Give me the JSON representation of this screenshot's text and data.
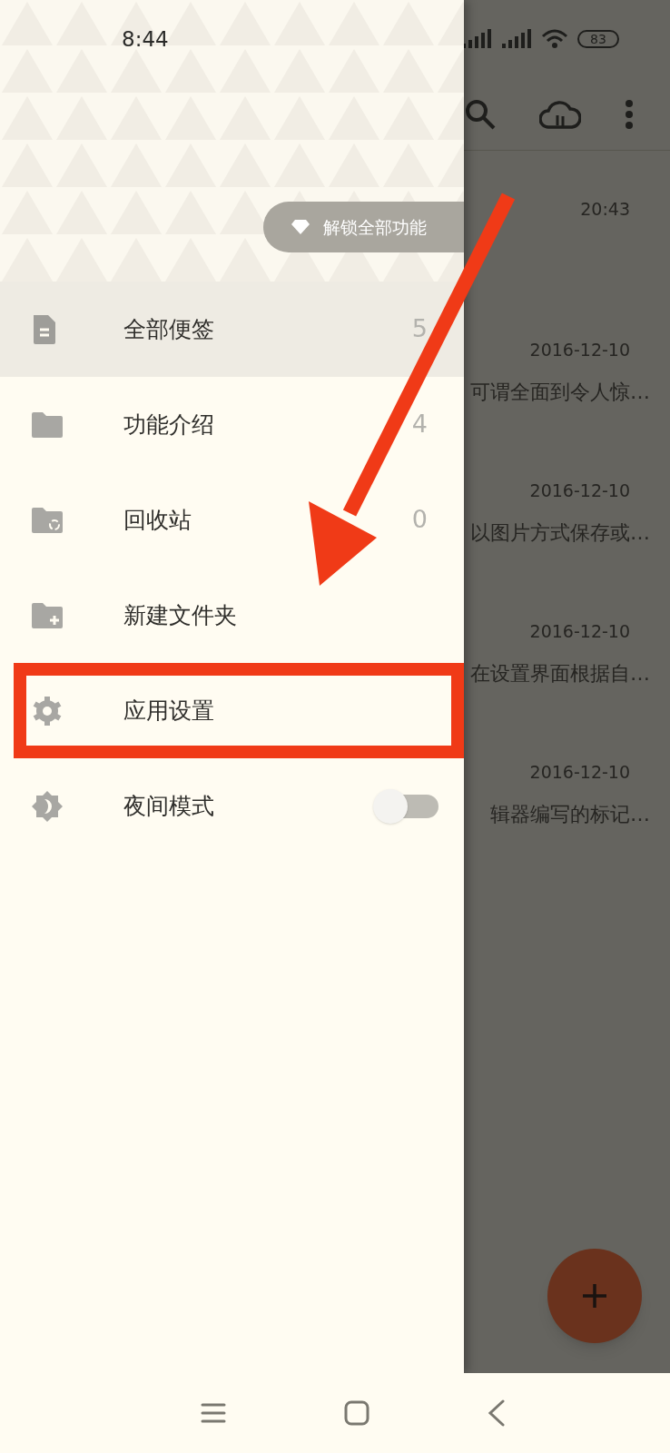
{
  "status_bar": {
    "time": "8:44",
    "battery": "83"
  },
  "drawer": {
    "unlock_button": "解锁全部功能",
    "items": [
      {
        "kind": "note",
        "label": "全部便签",
        "count": "5",
        "selected": true,
        "highlighted": false
      },
      {
        "kind": "folder",
        "label": "功能介绍",
        "count": "4",
        "selected": false,
        "highlighted": false
      },
      {
        "kind": "trash",
        "label": "回收站",
        "count": "0",
        "selected": false,
        "highlighted": false
      },
      {
        "kind": "new_folder",
        "label": "新建文件夹",
        "selected": false,
        "highlighted": false
      },
      {
        "kind": "settings",
        "label": "应用设置",
        "selected": false,
        "highlighted": true
      },
      {
        "kind": "night",
        "label": "夜间模式",
        "selected": false,
        "highlighted": false,
        "on": false
      }
    ]
  },
  "notes": [
    {
      "date": "20:43"
    },
    {
      "date": "2016-12-10",
      "snippet": "可谓全面到令人惊…"
    },
    {
      "date": "2016-12-10",
      "snippet": "以图片方式保存或…"
    },
    {
      "date": "2016-12-10",
      "snippet": "在设置界面根据自…"
    },
    {
      "date": "2016-12-10",
      "snippet": "辑器编写的标记…"
    }
  ]
}
